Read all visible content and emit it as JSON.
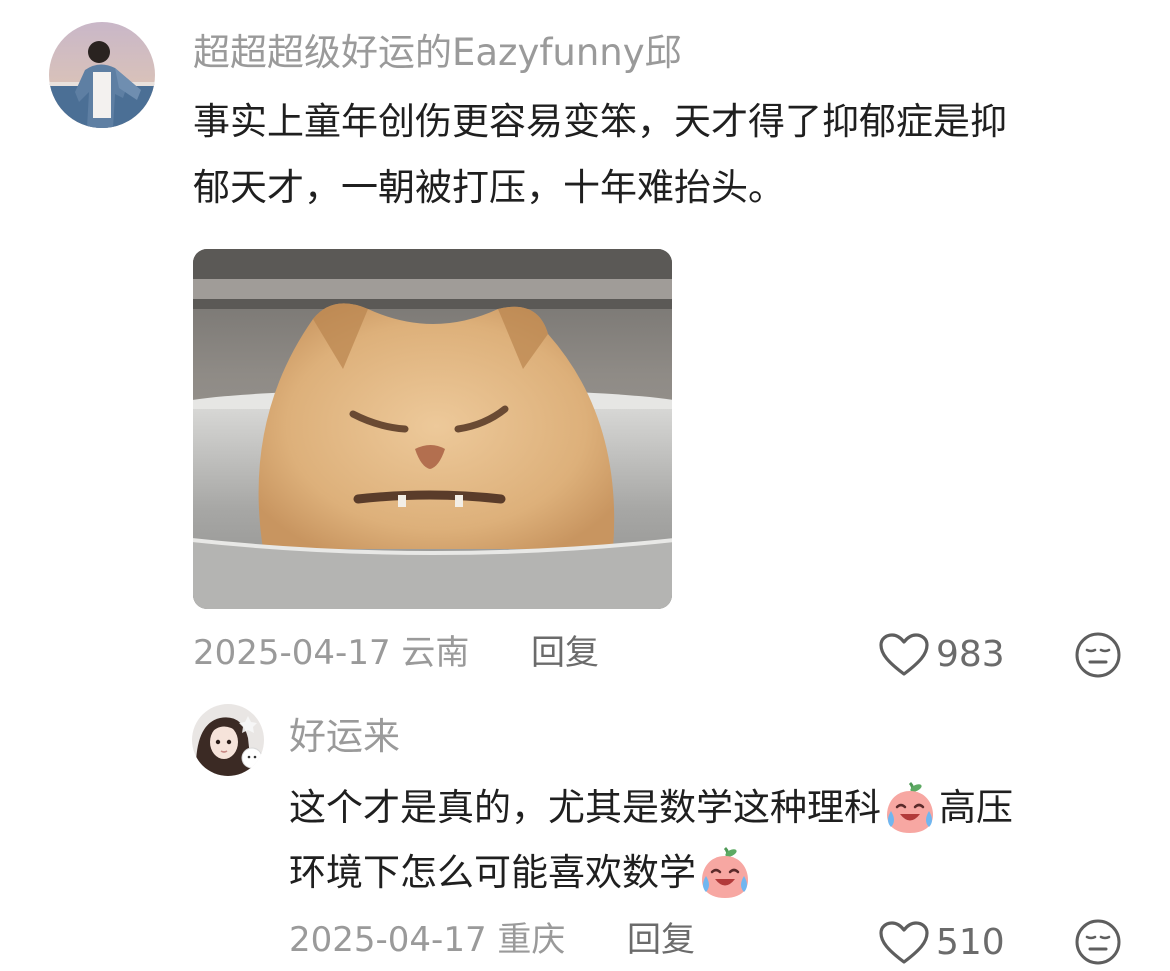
{
  "comment": {
    "username": "超超超级好运的Eazyfunny邱",
    "text_line1": "事实上童年创伤更容易变笨，天才得了抑郁症是抑",
    "text_line2": "郁天才，一朝被打压，十年难抬头。",
    "date_location": "2025-04-17 云南",
    "reply_label": "回复",
    "like_count": "983"
  },
  "reply": {
    "username": "好运来",
    "text_line1": "这个才是真的，尤其是数学这种理科",
    "text_line1_end": "高压",
    "text_line2": "环境下怎么可能喜欢数学",
    "date_location": "2025-04-17 重庆",
    "reply_label": "回复",
    "like_count": "510"
  },
  "icons": {
    "like": "heart-outline-icon",
    "dislike": "neutral-face-icon",
    "emoji": "crying-laughing-peach-emoji"
  },
  "colors": {
    "text": "#1f1f1f",
    "secondary": "#9a9a9a",
    "action": "#6b6b6b"
  }
}
